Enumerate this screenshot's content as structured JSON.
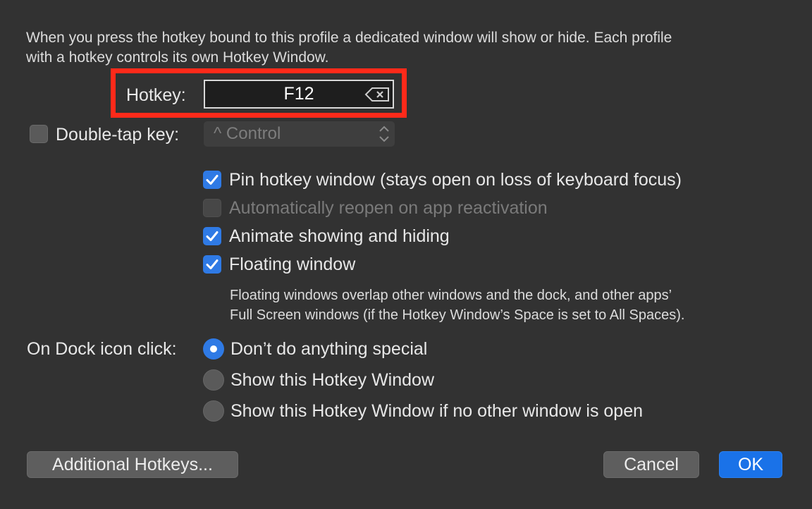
{
  "intro": {
    "line1": "When you press the hotkey bound to this profile a dedicated window will show or hide. Each profile",
    "line2": "with a hotkey controls its own Hotkey Window."
  },
  "hotkey": {
    "label": "Hotkey:",
    "value": "F12"
  },
  "double_tap": {
    "label": "Double-tap key:",
    "checked": false,
    "selected": "^ Control"
  },
  "options": [
    {
      "label": "Pin hotkey window (stays open on loss of keyboard focus)",
      "checked": true,
      "enabled": true
    },
    {
      "label": "Automatically reopen on app reactivation",
      "checked": false,
      "enabled": false
    },
    {
      "label": "Animate showing and hiding",
      "checked": true,
      "enabled": true
    },
    {
      "label": "Floating window",
      "checked": true,
      "enabled": true
    }
  ],
  "floating_note": {
    "line1": "Floating windows overlap other windows and the dock, and other apps’",
    "line2": "Full Screen windows (if the Hotkey Window’s Space is set to All Spaces)."
  },
  "dock_click": {
    "label": "On Dock icon click:",
    "choices": [
      {
        "label": "Don’t do anything special",
        "selected": true
      },
      {
        "label": "Show this Hotkey Window",
        "selected": false
      },
      {
        "label": "Show this Hotkey Window if no other window is open",
        "selected": false
      }
    ]
  },
  "buttons": {
    "additional": "Additional Hotkeys...",
    "cancel": "Cancel",
    "ok": "OK"
  },
  "colors": {
    "background": "#323232",
    "accent": "#2f7ae5",
    "highlight": "#ff2a1a"
  },
  "icons": {
    "clear": "delete-left-icon",
    "check": "checkmark-icon",
    "popup": "updown-chevron-icon"
  }
}
